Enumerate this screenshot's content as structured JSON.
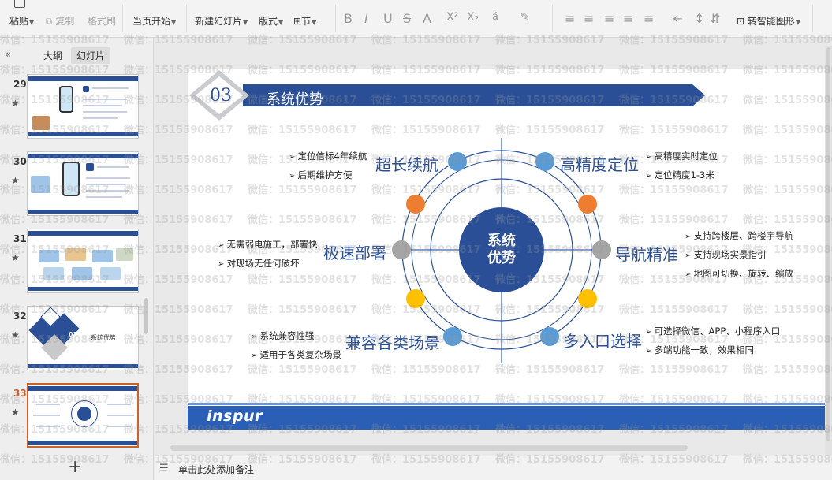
{
  "toolbar": {
    "paste": "粘贴",
    "copy": "复制",
    "format_painter": "格式刷",
    "play_from_current": "当页开始",
    "new_slide": "新建幻灯片",
    "layout": "版式",
    "section": "节",
    "smart_shape": "转智能图形",
    "font_buttons": [
      "B",
      "I",
      "U",
      "S",
      "A",
      "X²",
      "X₂"
    ]
  },
  "panel": {
    "tabs": [
      "大纲",
      "幻灯片"
    ],
    "active_tab": "幻灯片",
    "slides": [
      {
        "num": "29",
        "title": "运营商平台",
        "active": false
      },
      {
        "num": "30",
        "title": "运营平台展示",
        "active": false
      },
      {
        "num": "31",
        "title": "服务案例",
        "active": false
      },
      {
        "num": "32",
        "title": "系统优势",
        "active": false
      },
      {
        "num": "33",
        "title": "系统优势",
        "active": true
      }
    ],
    "thumb32_num": "03"
  },
  "slide": {
    "section_number": "03",
    "title": "系统优势",
    "center_label": [
      "系统",
      "优势"
    ],
    "features": [
      {
        "title": "超长续航",
        "bullets": [
          "定位信标4年续航",
          "后期维护方便"
        ]
      },
      {
        "title": "高精度定位",
        "bullets": [
          "高精度实时定位",
          "定位精度1-3米"
        ]
      },
      {
        "title": "极速部署",
        "bullets": [
          "无需弱电施工，部署快",
          "对现场无任何破坏"
        ]
      },
      {
        "title": "导航精准",
        "bullets": [
          "支持跨楼层、跨楼宇导航",
          "支持现场实景指引",
          "地图可切换、旋转、缩放"
        ]
      },
      {
        "title": "兼容各类场景",
        "bullets": [
          "系统兼容性强",
          "适用于各类复杂场景"
        ]
      },
      {
        "title": "多入口选择",
        "bullets": [
          "可选择微信、APP、小程序入口",
          "多端功能一致，效果相同"
        ]
      }
    ],
    "brand": "inspur",
    "colors": {
      "primary": "#2a4f96",
      "blue_dot": "#5b9bd5",
      "orange_dot": "#ed7d31",
      "gray_dot": "#a5a5a5",
      "yellow_dot": "#ffc000"
    }
  },
  "notes": {
    "placeholder": "单击此处添加备注"
  },
  "watermark": {
    "text": "微信：15155908617"
  }
}
